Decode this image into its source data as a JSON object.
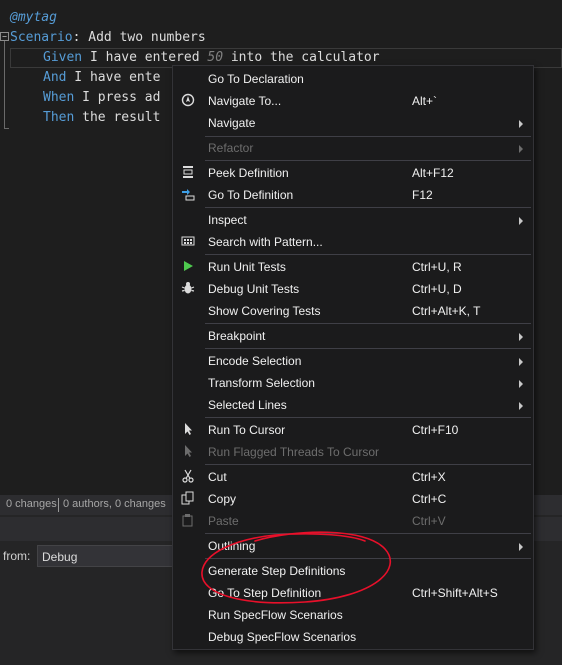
{
  "editor": {
    "tag": "@mytag",
    "scenario_keyword": "Scenario",
    "scenario_text": ": Add two numbers",
    "lines": [
      {
        "keyword": "Given",
        "before": " I have entered ",
        "value": "50",
        "after": " into the calculator"
      },
      {
        "keyword": "And",
        "text": " I have ente"
      },
      {
        "keyword": "When",
        "text": " I press ad"
      },
      {
        "keyword": "Then",
        "text": " the result"
      }
    ],
    "fold_glyph": "−"
  },
  "status_bar": {
    "changes": "0 changes",
    "authors": "0 authors, 0 changes"
  },
  "panel": {
    "from_label": "from:",
    "from_value": "Debug"
  },
  "context_menu": {
    "items": [
      {
        "label": "Go To Declaration",
        "shortcut": ""
      },
      {
        "label": "Navigate To...",
        "shortcut": "Alt+`"
      },
      {
        "label": "Navigate",
        "shortcut": ""
      },
      {
        "label": "Refactor",
        "shortcut": ""
      },
      {
        "label": "Peek Definition",
        "shortcut": "Alt+F12"
      },
      {
        "label": "Go To Definition",
        "shortcut": "F12"
      },
      {
        "label": "Inspect",
        "shortcut": ""
      },
      {
        "label": "Search with Pattern...",
        "shortcut": ""
      },
      {
        "label": "Run Unit Tests",
        "shortcut": "Ctrl+U, R"
      },
      {
        "label": "Debug Unit Tests",
        "shortcut": "Ctrl+U, D"
      },
      {
        "label": "Show Covering Tests",
        "shortcut": "Ctrl+Alt+K, T"
      },
      {
        "label": "Breakpoint",
        "shortcut": ""
      },
      {
        "label": "Encode Selection",
        "shortcut": ""
      },
      {
        "label": "Transform Selection",
        "shortcut": ""
      },
      {
        "label": "Selected Lines",
        "shortcut": ""
      },
      {
        "label": "Run To Cursor",
        "shortcut": "Ctrl+F10"
      },
      {
        "label": "Run Flagged Threads To Cursor",
        "shortcut": ""
      },
      {
        "label": "Cut",
        "shortcut": "Ctrl+X"
      },
      {
        "label": "Copy",
        "shortcut": "Ctrl+C"
      },
      {
        "label": "Paste",
        "shortcut": "Ctrl+V"
      },
      {
        "label": "Outlining",
        "shortcut": ""
      },
      {
        "label": "Generate Step Definitions",
        "shortcut": ""
      },
      {
        "label": "Go To Step Definition",
        "shortcut": "Ctrl+Shift+Alt+S"
      },
      {
        "label": "Run SpecFlow Scenarios",
        "shortcut": ""
      },
      {
        "label": "Debug SpecFlow Scenarios",
        "shortcut": ""
      }
    ]
  },
  "colors": {
    "editor_bg": "#1e1e1e",
    "menu_bg": "#1b1b1c",
    "keyword": "#569cd6",
    "annotation": "#e8102a",
    "run_icon": "#4ec94e"
  }
}
